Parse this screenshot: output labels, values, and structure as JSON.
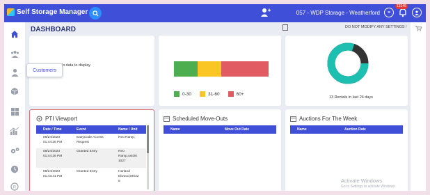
{
  "app": {
    "title": "Self Storage Manager"
  },
  "header": {
    "store_selector": "057 - WDP Storage - Weatherford",
    "notification_count": "13146"
  },
  "sidebar": {
    "tooltip": "Customers"
  },
  "page": {
    "title": "DASHBOARD",
    "notice": "DO NOT MODIFY ANY SETTINGS !"
  },
  "widgets": {
    "first": {
      "no_data": "No data to display"
    },
    "aging": {
      "segments": [
        {
          "label": "0-30",
          "color": "#4cae4f",
          "share": 0.25
        },
        {
          "label": "31-60",
          "color": "#f9c623",
          "share": 0.25
        },
        {
          "label": "60+",
          "color": "#e15b63",
          "share": 0.5
        }
      ]
    },
    "rentals": {
      "caption": "13 Rentals in last 24 days",
      "ring_colors": {
        "main": "#1dbfb0",
        "rest": "#333333"
      },
      "main_share": 0.8
    }
  },
  "pti": {
    "title": "PTI Viewport",
    "columns": [
      "Date / Time",
      "Event",
      "Name / Unit"
    ],
    "rows": [
      {
        "date": "08/24/2023",
        "time": "01:44:26 PM",
        "event": "EasyCode Access",
        "event2": "Request",
        "name": "Reo Ramp,",
        "name2": "",
        "name3": ""
      },
      {
        "date": "08/24/2023",
        "time": "01:44:26 PM",
        "event": "Granted Entry",
        "event2": "",
        "name": "Reo",
        "name2": "Ramp,ustOK",
        "name3": "1027"
      },
      {
        "date": "08/24/2023",
        "time": "01:43:41 PM",
        "event": "Granted Entry",
        "event2": "",
        "name": "Harland",
        "name2": "Elwood,MX22",
        "name3": "8"
      }
    ]
  },
  "moveouts": {
    "title": "Scheduled Move-Outs",
    "columns": [
      "Name",
      "Move Out Date"
    ]
  },
  "auctions": {
    "title": "Auctions For The Week",
    "columns": [
      "Name",
      "Auction Date"
    ]
  },
  "watermark": {
    "line1": "Activate Windows",
    "line2": "Go to Settings to activate Windows."
  }
}
